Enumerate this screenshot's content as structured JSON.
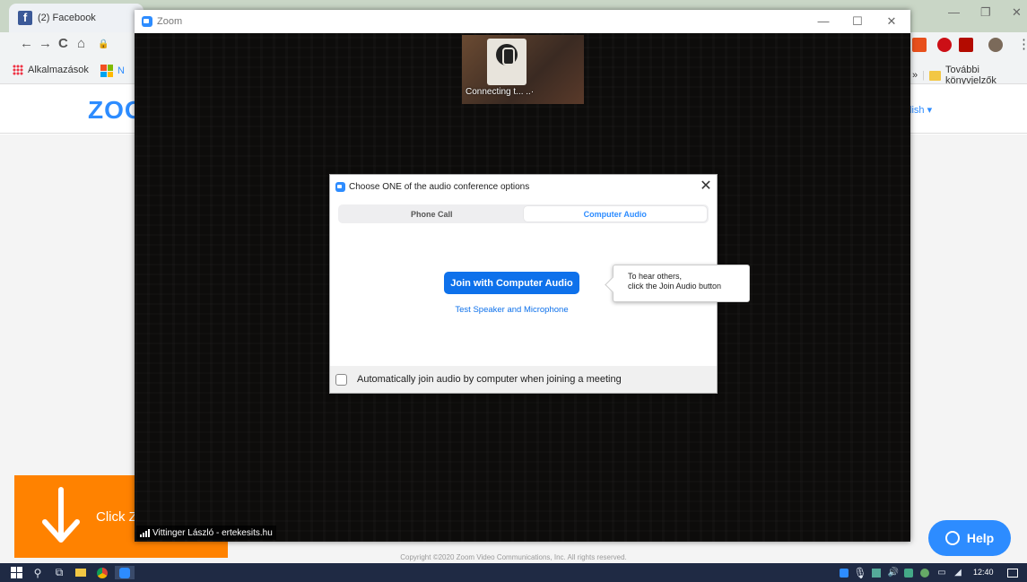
{
  "browser": {
    "tab_title": "(2) Facebook",
    "bookmarks": {
      "apps_label": "Alkalmazások",
      "ms_label": "N",
      "more_label": "További könyvjelzők"
    },
    "page": {
      "logo_text": "ZOO",
      "language": "lish",
      "download_text": "Click Z",
      "help_label": "Help",
      "copyright": "Copyright ©2020 Zoom Video Communications, Inc. All rights reserved."
    }
  },
  "zoom_window": {
    "title": "Zoom",
    "thumbnail_status": "Connecting t... ..·",
    "participant_name": "Vittinger László - ertekesits.hu"
  },
  "audio_dialog": {
    "title": "Choose ONE of the audio conference options",
    "tabs": [
      {
        "label": "Phone Call",
        "active": false
      },
      {
        "label": "Computer Audio",
        "active": true
      }
    ],
    "join_button": "Join with Computer Audio",
    "test_link": "Test Speaker and Microphone",
    "auto_join_label": "Automatically join audio by computer when joining a meeting",
    "auto_join_checked": false,
    "tooltip_line1": "To hear others,",
    "tooltip_line2": "click the Join Audio button"
  },
  "taskbar": {
    "clock": "12:40"
  },
  "colors": {
    "zoom_blue": "#0e71eb",
    "zoom_brand": "#2d8cff",
    "download_orange": "#ff8200",
    "taskbar": "#1f2a44"
  }
}
